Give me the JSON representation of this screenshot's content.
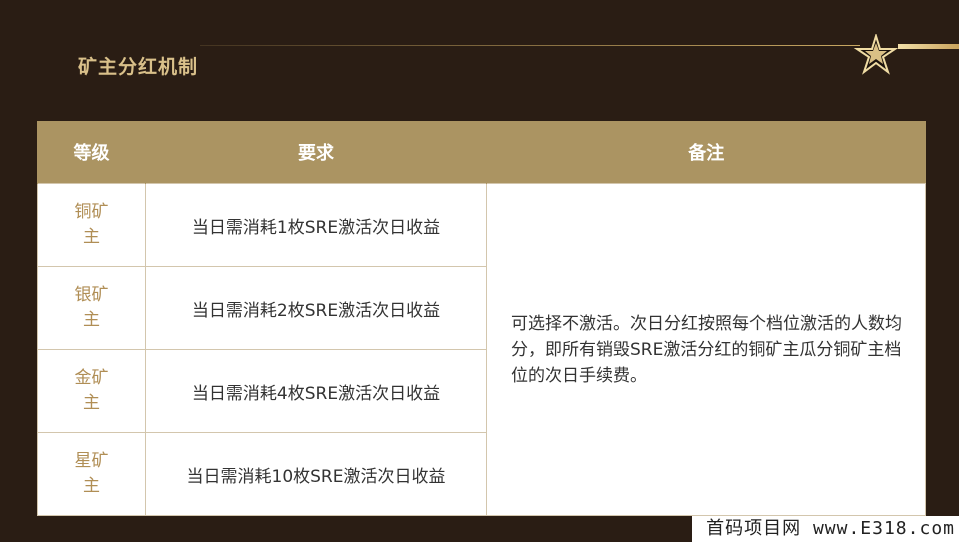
{
  "title": "矿主分红机制",
  "table": {
    "headers": [
      "等级",
      "要求",
      "备注"
    ],
    "rows": [
      {
        "level": "铜矿主",
        "requirement": "当日需消耗1枚SRE激活次日收益"
      },
      {
        "level": "银矿主",
        "requirement": "当日需消耗2枚SRE激活次日收益"
      },
      {
        "level": "金矿主",
        "requirement": "当日需消耗4枚SRE激活次日收益"
      },
      {
        "level": "星矿主",
        "requirement": "当日需消耗10枚SRE激活次日收益"
      }
    ],
    "note": "可选择不激活。次日分红按照每个档位激活的人数均分，即所有销毁SRE激活分红的铜矿主瓜分铜矿主档位的次日手续费。"
  },
  "watermark": "首码项目网 www.E318.com",
  "colors": {
    "background": "#2a1d14",
    "header": "#ab9462",
    "accent": "#d9c08a"
  },
  "icons": [
    "star-icon"
  ]
}
